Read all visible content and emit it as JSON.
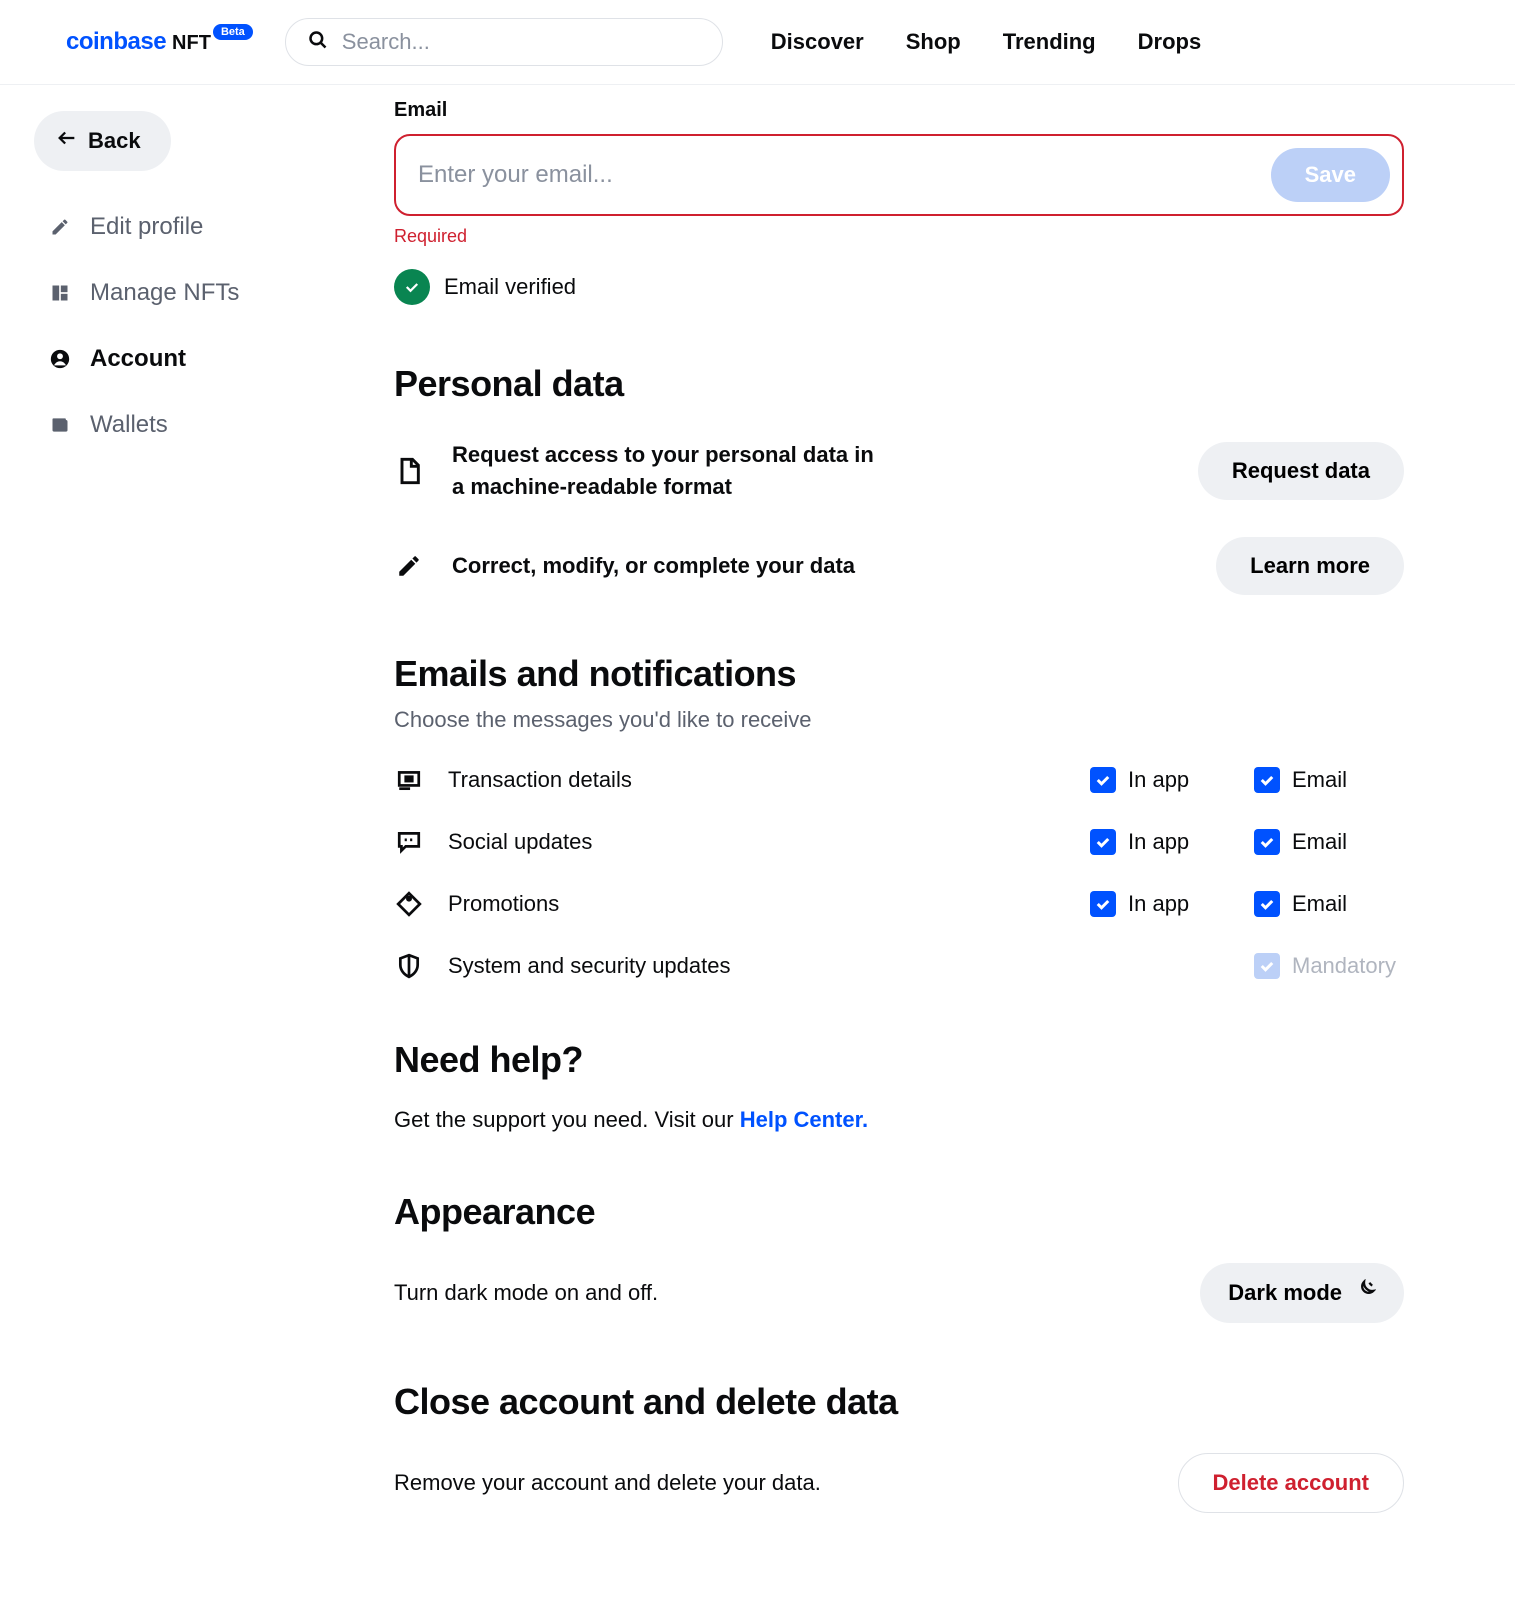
{
  "header": {
    "logo_main": "coinbase",
    "logo_sub": "NFT",
    "beta": "Beta",
    "search_placeholder": "Search...",
    "nav": [
      "Discover",
      "Shop",
      "Trending",
      "Drops"
    ]
  },
  "sidebar": {
    "back": "Back",
    "items": [
      {
        "label": "Edit profile",
        "icon": "pencil-icon",
        "active": false
      },
      {
        "label": "Manage NFTs",
        "icon": "grid-icon",
        "active": false
      },
      {
        "label": "Account",
        "icon": "user-icon",
        "active": true
      },
      {
        "label": "Wallets",
        "icon": "wallet-icon",
        "active": false
      }
    ]
  },
  "email": {
    "label": "Email",
    "placeholder": "Enter your email...",
    "value": "",
    "save": "Save",
    "error": "Required",
    "verified": "Email verified"
  },
  "personal": {
    "heading": "Personal data",
    "row1_text": "Request access to your personal data in a machine-readable format",
    "row1_btn": "Request data",
    "row2_text": "Correct, modify, or complete your data",
    "row2_btn": "Learn more"
  },
  "notifs": {
    "heading": "Emails and notifications",
    "sub": "Choose the messages you'd like to receive",
    "col_inapp": "In app",
    "col_email": "Email",
    "col_mandatory": "Mandatory",
    "rows": [
      {
        "label": "Transaction details",
        "icon": "receipt-icon",
        "inapp": true,
        "email": true
      },
      {
        "label": "Social updates",
        "icon": "chat-icon",
        "inapp": true,
        "email": true
      },
      {
        "label": "Promotions",
        "icon": "tag-icon",
        "inapp": true,
        "email": true
      }
    ],
    "system_label": "System and security updates"
  },
  "help": {
    "heading": "Need help?",
    "text": "Get the support you need. Visit our ",
    "link": "Help Center."
  },
  "appearance": {
    "heading": "Appearance",
    "text": "Turn dark mode on and off.",
    "btn": "Dark mode"
  },
  "close": {
    "heading": "Close account and delete data",
    "text": "Remove your account and delete your data.",
    "btn": "Delete account"
  }
}
